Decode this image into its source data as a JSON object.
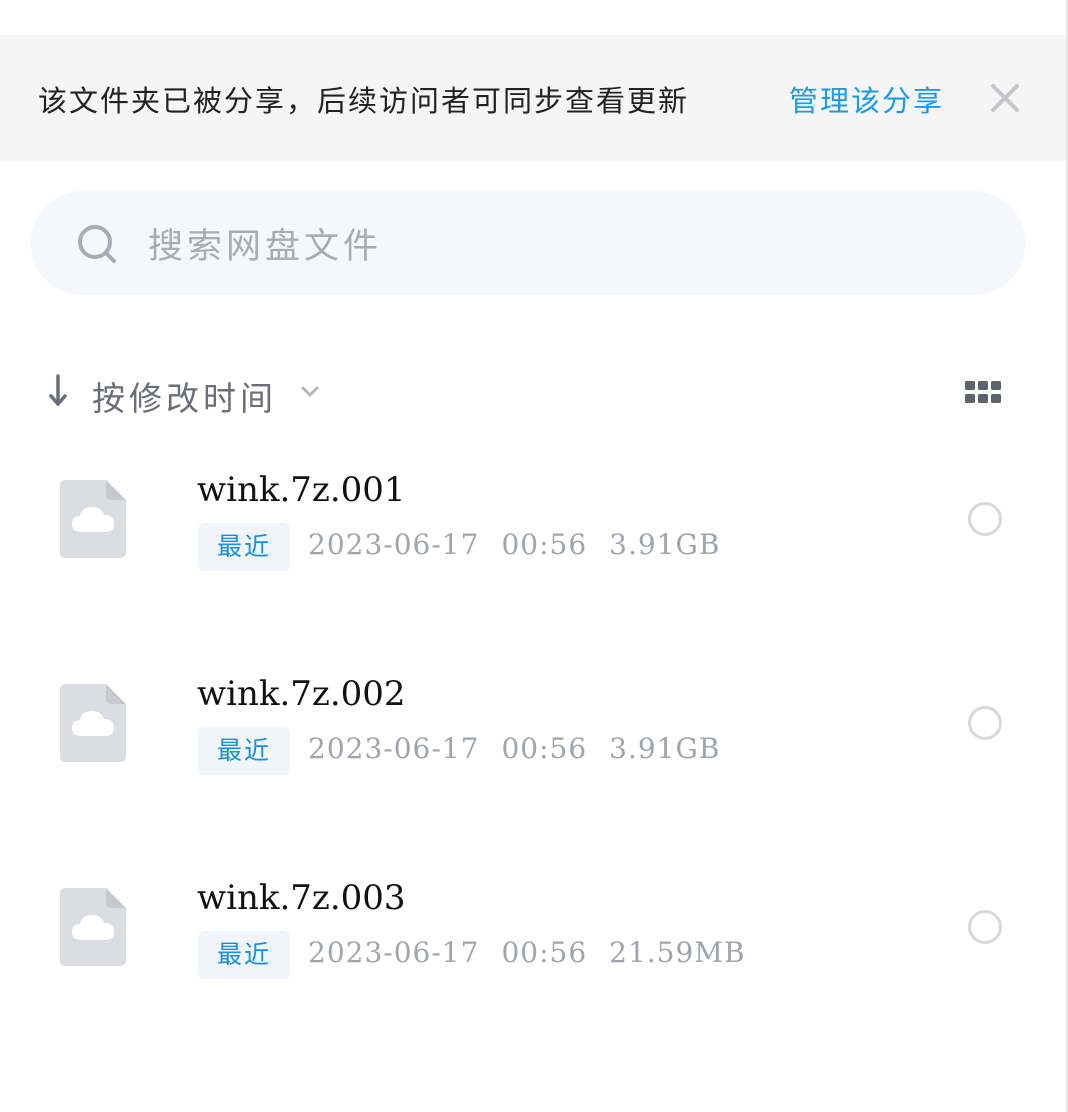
{
  "banner": {
    "text": "该文件夹已被分享，后续访问者可同步查看更新",
    "manage_link": "管理该分享",
    "close_icon": "close-icon"
  },
  "search": {
    "placeholder": "搜索网盘文件",
    "icon": "search-icon"
  },
  "sort": {
    "label": "按修改时间",
    "direction_icon": "arrow-down-icon",
    "dropdown_icon": "chevron-down-icon"
  },
  "view_toggle": {
    "icon": "grid-view-icon"
  },
  "files": [
    {
      "name": "wink.7z.001",
      "badge": "最近",
      "date": "2023-06-17",
      "time": "00:56",
      "size": "3.91GB",
      "icon": "cloud-file-icon"
    },
    {
      "name": "wink.7z.002",
      "badge": "最近",
      "date": "2023-06-17",
      "time": "00:56",
      "size": "3.91GB",
      "icon": "cloud-file-icon"
    },
    {
      "name": "wink.7z.003",
      "badge": "最近",
      "date": "2023-06-17",
      "time": "00:56",
      "size": "21.59MB",
      "icon": "cloud-file-icon"
    }
  ],
  "colors": {
    "accent": "#1a9be8",
    "banner_bg": "#f5f5f5",
    "search_bg": "#f5f7fa",
    "badge_bg": "#f1f5fa",
    "muted_text": "#a0a4ab"
  }
}
